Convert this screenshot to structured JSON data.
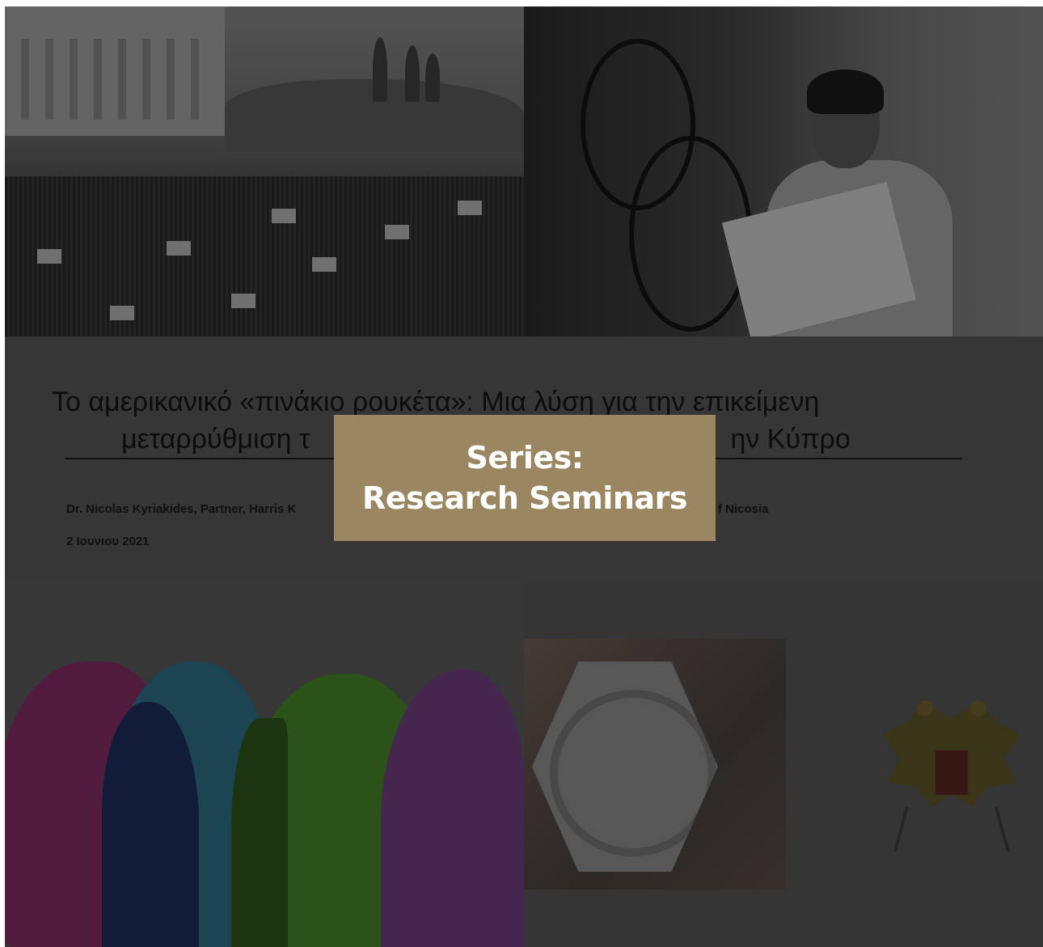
{
  "slide": {
    "title_line1": "Το αμερικανικό «πινάκιο ρουκέτα»: Μια λύση για την επικείμενη",
    "title_line2_left": "μεταρρύθμιση τ",
    "title_line2_right": "ην Κύπρο",
    "author_left": "Dr. Nicolas Kyriakides, Partner, Harris K",
    "author_right": "f Nicosia",
    "date": "2 Ιουνιου 2021"
  },
  "card": {
    "line1": "Series:",
    "line2": "Research Seminars"
  },
  "colors": {
    "card_bg": "#9a8660",
    "card_text": "#ffffff"
  }
}
